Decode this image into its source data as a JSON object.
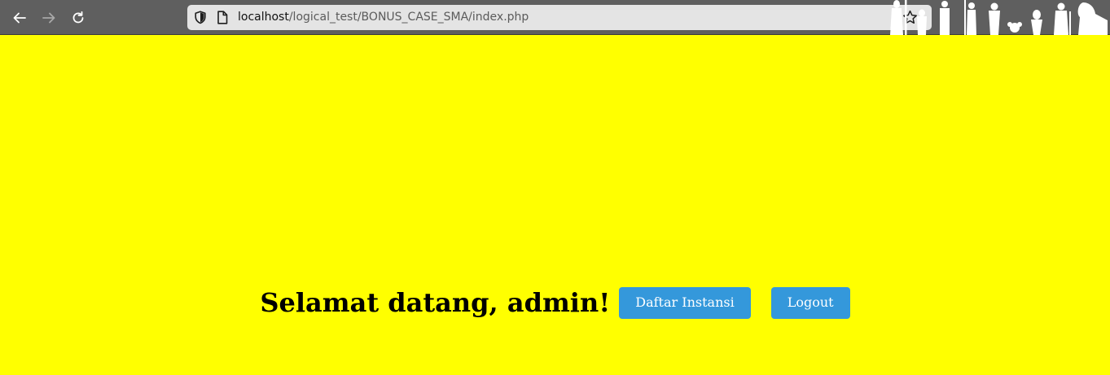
{
  "browser": {
    "url_host": "localhost",
    "url_path": "/logical_test/BONUS_CASE_SMA/index.php",
    "icons": [
      "back-arrow-icon",
      "forward-arrow-icon",
      "reload-icon",
      "shield-icon",
      "page-icon",
      "bookmark-star-icon"
    ]
  },
  "page": {
    "background_color": "#ffff00",
    "welcome_text": "Selamat datang, admin!",
    "buttons": {
      "daftar_instansi": "Daftar Instansi",
      "logout": "Logout"
    },
    "button_color": "#3498db"
  }
}
